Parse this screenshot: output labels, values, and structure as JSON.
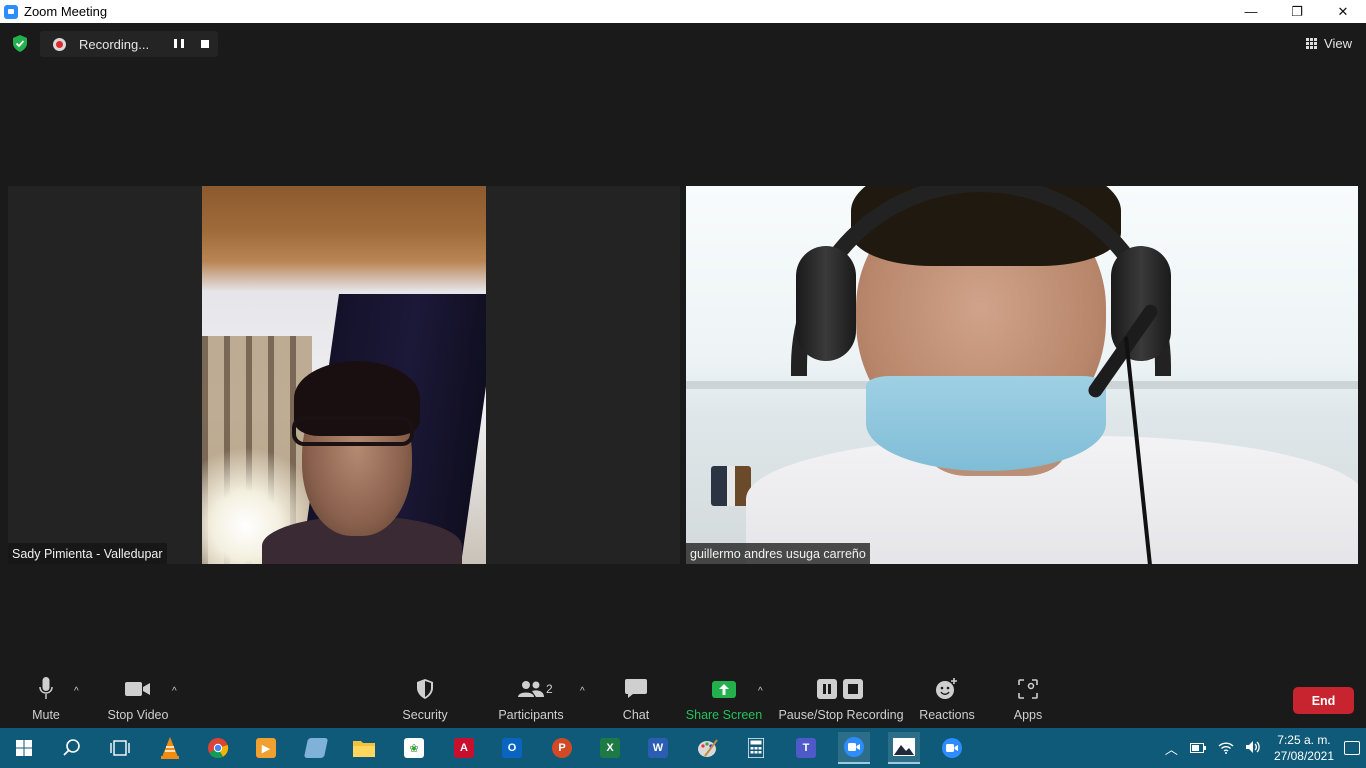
{
  "window": {
    "title": "Zoom Meeting",
    "minimize": "—",
    "restore": "❐",
    "close": "✕"
  },
  "recording": {
    "label": "Recording..."
  },
  "view": {
    "label": "View"
  },
  "participants": [
    {
      "name": "Sady Pimienta - Valledupar"
    },
    {
      "name": "guillermo andres usuga carreño"
    }
  ],
  "toolbar": {
    "mute": "Mute",
    "stop_video": "Stop Video",
    "security": "Security",
    "participants": "Participants",
    "participants_count": "2",
    "chat": "Chat",
    "share_screen": "Share Screen",
    "pause_stop_recording": "Pause/Stop Recording",
    "reactions": "Reactions",
    "apps": "Apps",
    "end": "End",
    "caret": "^"
  },
  "taskbar": {
    "time": "7:25 a. m.",
    "date": "27/08/2021",
    "apps": [
      "start",
      "search",
      "task-view",
      "vlc",
      "chrome",
      "media-player",
      "notes",
      "file-explorer",
      "green-app",
      "acrobat",
      "outlook",
      "powerpoint",
      "excel",
      "word",
      "paint",
      "calculator",
      "teams",
      "zoom",
      "photos",
      "zoom-2"
    ]
  },
  "colors": {
    "accent": "#2d8cff",
    "end_button": "#c8242f",
    "share_green": "#22b14c",
    "taskbar": "#0f5a78",
    "background": "#1a1a1a"
  }
}
